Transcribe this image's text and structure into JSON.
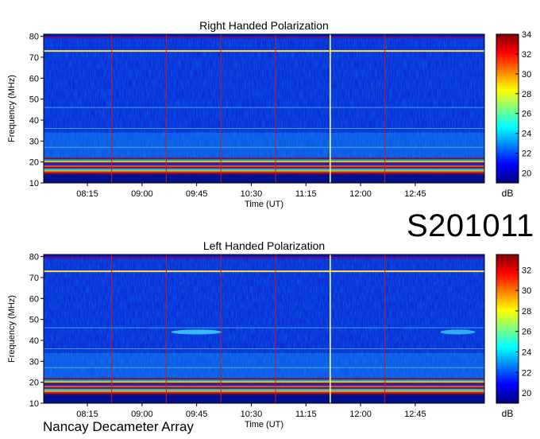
{
  "observation_id": "S201011",
  "instrument": "Nancay Decameter Array",
  "chart_data": [
    {
      "type": "heatmap",
      "title": "Right Handed Polarization",
      "xlabel": "Time (UT)",
      "ylabel": "Frequency (MHz)",
      "x_ticks": [
        "08:15",
        "09:00",
        "09:45",
        "10:30",
        "11:15",
        "12:00",
        "12:45"
      ],
      "x_range": [
        "07:39",
        "13:42"
      ],
      "y_ticks": [
        10,
        20,
        30,
        40,
        50,
        60,
        70,
        80
      ],
      "y_range": [
        10,
        81
      ],
      "colorbar": {
        "label": "dB",
        "ticks": [
          20,
          22,
          24,
          26,
          28,
          30,
          32,
          34
        ],
        "range": [
          19,
          34
        ]
      },
      "features": {
        "strong_band_mhz": [
          14,
          22
        ],
        "rfi_lines_mhz": [
          73,
          79.5
        ],
        "time_markers_ut": [
          "08:35",
          "09:20",
          "10:05",
          "10:50",
          "11:35",
          "12:20"
        ],
        "bright_time_marker_ut": "11:35"
      }
    },
    {
      "type": "heatmap",
      "title": "Left Handed Polarization",
      "xlabel": "Time (UT)",
      "ylabel": "Frequency (MHz)",
      "x_ticks": [
        "08:15",
        "09:00",
        "09:45",
        "10:30",
        "11:15",
        "12:00",
        "12:45"
      ],
      "x_range": [
        "07:39",
        "13:42"
      ],
      "y_ticks": [
        10,
        20,
        30,
        40,
        50,
        60,
        70,
        80
      ],
      "y_range": [
        10,
        81
      ],
      "colorbar": {
        "label": "dB",
        "ticks": [
          20,
          22,
          24,
          26,
          28,
          30,
          32
        ],
        "range": [
          19,
          33.5
        ]
      },
      "features": {
        "strong_band_mhz": [
          14,
          22
        ],
        "rfi_lines_mhz": [
          73,
          79.5
        ],
        "blob_mhz": 44,
        "time_markers_ut": [
          "08:35",
          "09:20",
          "10:05",
          "10:50",
          "11:35",
          "12:20"
        ],
        "bright_time_marker_ut": "11:35"
      }
    }
  ]
}
